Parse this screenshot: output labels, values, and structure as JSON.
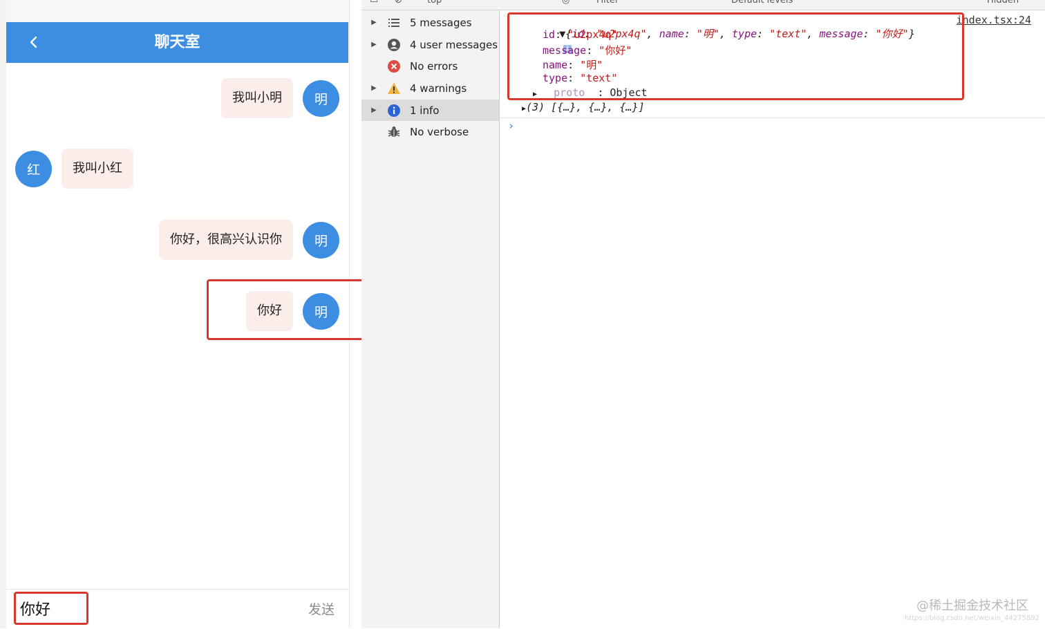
{
  "chat": {
    "title": "聊天室",
    "messages": [
      {
        "side": "right",
        "avatar": "明",
        "text": "我叫小明"
      },
      {
        "side": "left",
        "avatar": "红",
        "text": "我叫小红"
      },
      {
        "side": "right",
        "avatar": "明",
        "text": "你好，很高兴认识你"
      },
      {
        "side": "right",
        "avatar": "明",
        "text": "你好"
      }
    ],
    "input_value": "你好",
    "send_label": "发送",
    "colors": {
      "header": "#3d8ee3",
      "bubble": "#fbeeea",
      "highlight": "#d6382e"
    }
  },
  "devtools": {
    "toolbar_fragments": [
      "top",
      "Filter",
      "Default levels",
      "Hidden"
    ],
    "sidebar": [
      {
        "label": "5 messages",
        "icon": "list-icon",
        "expandable": true
      },
      {
        "label": "4 user messages",
        "icon": "user-icon",
        "expandable": true
      },
      {
        "label": "No errors",
        "icon": "error-icon",
        "expandable": false
      },
      {
        "label": "4 warnings",
        "icon": "warning-icon",
        "expandable": true
      },
      {
        "label": "1 info",
        "icon": "info-icon",
        "expandable": true,
        "selected": true
      },
      {
        "label": "No verbose",
        "icon": "bug-icon",
        "expandable": false
      }
    ],
    "console": {
      "source_link": "index.tsx:24",
      "obj": {
        "id": "u2px4q",
        "name": "明",
        "type": "text",
        "message": "你好"
      },
      "proto_key": "__proto__",
      "proto_value": "Object",
      "array_summary": "(3) [{…}, {…}, {…}]"
    }
  },
  "watermark": {
    "text": "@稀土掘金技术社区",
    "url": "https://blog.csdn.net/weixin_44275892"
  }
}
